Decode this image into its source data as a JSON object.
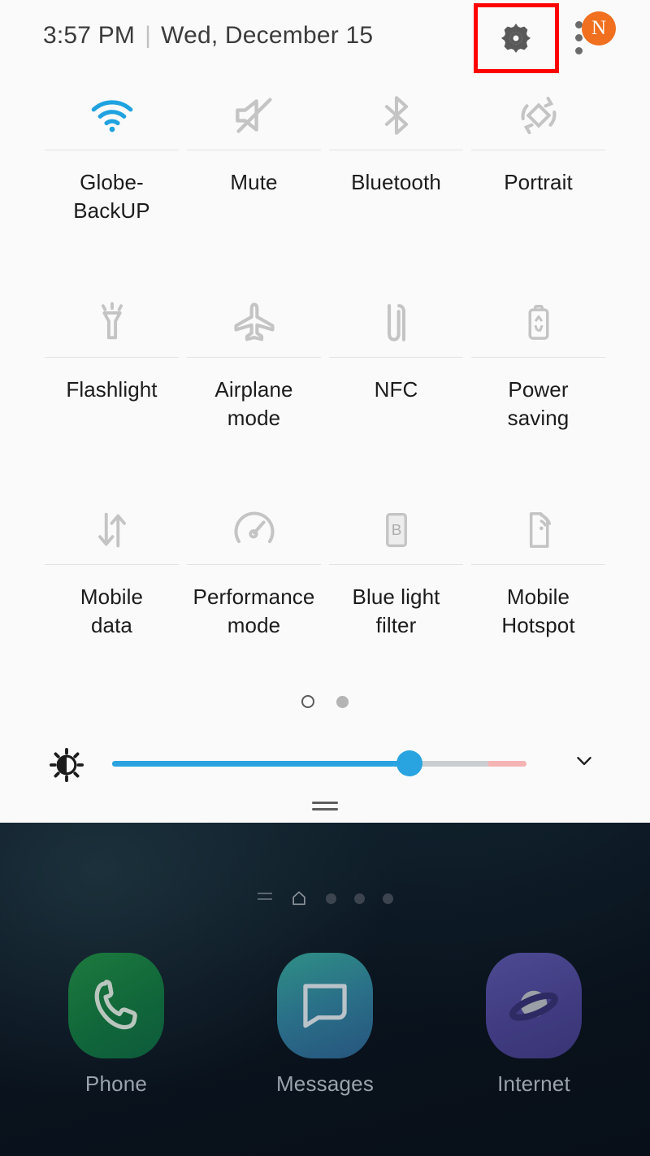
{
  "statusbar": {
    "time": "3:57 PM",
    "divider": "|",
    "date": "Wed, December 15",
    "gear_icon": "gear-icon",
    "overflow_icon": "three-dots-vertical-icon",
    "badge_letter": "N",
    "highlight_color": "#ff0000",
    "badge_color": "#f07020"
  },
  "quick_settings": {
    "rows": [
      [
        {
          "label": "Globe-\nBackUP",
          "icon": "wifi-icon",
          "active": true,
          "color": "#1fa2e0"
        },
        {
          "label": "Mute",
          "icon": "volume-mute-icon",
          "active": false,
          "color": "#c4c4c4"
        },
        {
          "label": "Bluetooth",
          "icon": "bluetooth-icon",
          "active": false,
          "color": "#c4c4c4"
        },
        {
          "label": "Portrait",
          "icon": "auto-rotate-icon",
          "active": false,
          "color": "#c4c4c4"
        }
      ],
      [
        {
          "label": "Flashlight",
          "icon": "flashlight-icon",
          "active": false,
          "color": "#c4c4c4"
        },
        {
          "label": "Airplane\nmode",
          "icon": "airplane-icon",
          "active": false,
          "color": "#c4c4c4"
        },
        {
          "label": "NFC",
          "icon": "nfc-icon",
          "active": false,
          "color": "#c4c4c4"
        },
        {
          "label": "Power\nsaving",
          "icon": "battery-power-saving-icon",
          "active": false,
          "color": "#c4c4c4"
        }
      ],
      [
        {
          "label": "Mobile\ndata",
          "icon": "mobile-data-arrows-icon",
          "active": false,
          "color": "#c4c4c4"
        },
        {
          "label": "Performance\nmode",
          "icon": "speedometer-icon",
          "active": false,
          "color": "#c4c4c4"
        },
        {
          "label": "Blue light\nfilter",
          "icon": "blue-light-filter-icon",
          "active": false,
          "color": "#c4c4c4"
        },
        {
          "label": "Mobile\nHotspot",
          "icon": "hotspot-icon",
          "active": false,
          "color": "#c4c4c4"
        }
      ]
    ],
    "page_indicator": {
      "pages": 2,
      "current": 1
    }
  },
  "brightness": {
    "icon": "brightness-sun-icon",
    "value_percent": 73,
    "track_color": "#2aa4e0",
    "remaining_color": "#c9ced1",
    "warning_color": "#f5b4b4",
    "expand_icon": "chevron-down-icon"
  },
  "panel_handle": "drag-handle",
  "home_screen": {
    "indicators": {
      "menu_icon": "list-lines-icon",
      "home_icon": "home-icon",
      "dots": 3
    },
    "dock": [
      {
        "label": "Phone",
        "icon": "phone-handset-icon",
        "color": "#16703c"
      },
      {
        "label": "Messages",
        "icon": "message-bubble-icon",
        "color": "#2a6f88"
      },
      {
        "label": "Internet",
        "icon": "saturn-browser-icon",
        "color": "#413c82"
      }
    ]
  }
}
